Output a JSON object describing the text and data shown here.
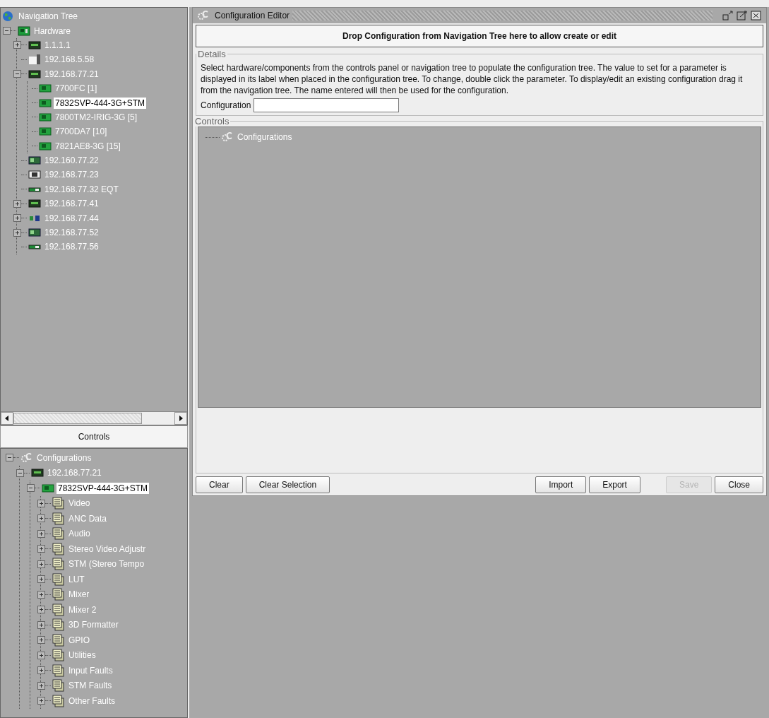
{
  "navigation_tree": {
    "root": {
      "label": "Navigation Tree",
      "kind": "globe",
      "selected": false
    },
    "items": [
      {
        "label": "Hardware",
        "kind": "rack",
        "expanded": true,
        "selected": false,
        "children": [
          {
            "label": "1.1.1.1",
            "kind": "chassis",
            "expanded": false,
            "selected": false
          },
          {
            "label": "192.168.5.58",
            "kind": "server",
            "selected": false
          },
          {
            "label": "192.168.77.21",
            "kind": "chassis",
            "expanded": true,
            "selected": false,
            "children": [
              {
                "label": "7700FC  [1]",
                "kind": "card",
                "selected": false
              },
              {
                "label": "7832SVP-444-3G+STM",
                "kind": "card",
                "selected": true
              },
              {
                "label": "7800TM2-IRIG-3G  [5]",
                "kind": "card",
                "selected": false
              },
              {
                "label": "7700DA7  [10]",
                "kind": "card",
                "selected": false
              },
              {
                "label": "7821AE8-3G  [15]",
                "kind": "card",
                "selected": false
              }
            ]
          },
          {
            "label": "192.160.77.22",
            "kind": "board",
            "selected": false
          },
          {
            "label": "192.168.77.23",
            "kind": "frame",
            "selected": false
          },
          {
            "label": "192.168.77.32 EQT",
            "kind": "slim",
            "selected": false
          },
          {
            "label": "192.168.77.41",
            "kind": "chassis",
            "expanded": false,
            "selected": false
          },
          {
            "label": "192.168.77.44",
            "kind": "link",
            "expanded": false,
            "selected": false
          },
          {
            "label": "192.168.77.52",
            "kind": "board",
            "expanded": false,
            "selected": false
          },
          {
            "label": "192.168.77.56",
            "kind": "slim",
            "selected": false
          }
        ]
      }
    ]
  },
  "controls_panel": {
    "title": "Controls",
    "items": [
      {
        "label": "Configurations",
        "kind": "config",
        "expanded": true,
        "selected": false,
        "children": [
          {
            "label": "192.168.77.21",
            "kind": "chassis",
            "expanded": true,
            "selected": false,
            "children": [
              {
                "label": "7832SVP-444-3G+STM",
                "kind": "card",
                "expanded": true,
                "selected": true,
                "children": [
                  {
                    "label": "Video",
                    "kind": "group",
                    "expanded": false,
                    "selected": false
                  },
                  {
                    "label": "ANC Data",
                    "kind": "group",
                    "expanded": false,
                    "selected": false
                  },
                  {
                    "label": "Audio",
                    "kind": "group",
                    "expanded": false,
                    "selected": false
                  },
                  {
                    "label": "Stereo Video Adjustr",
                    "kind": "group",
                    "expanded": false,
                    "selected": false
                  },
                  {
                    "label": "STM (Stereo Tempo",
                    "kind": "group",
                    "expanded": false,
                    "selected": false
                  },
                  {
                    "label": "LUT",
                    "kind": "group",
                    "expanded": false,
                    "selected": false
                  },
                  {
                    "label": "Mixer",
                    "kind": "group",
                    "expanded": false,
                    "selected": false
                  },
                  {
                    "label": "Mixer 2",
                    "kind": "group",
                    "expanded": false,
                    "selected": false
                  },
                  {
                    "label": "3D Formatter",
                    "kind": "group",
                    "expanded": false,
                    "selected": false
                  },
                  {
                    "label": "GPIO",
                    "kind": "group",
                    "expanded": false,
                    "selected": false
                  },
                  {
                    "label": "Utilities",
                    "kind": "group",
                    "expanded": false,
                    "selected": false
                  },
                  {
                    "label": "Input Faults",
                    "kind": "group",
                    "expanded": false,
                    "selected": false
                  },
                  {
                    "label": "STM Faults",
                    "kind": "group",
                    "expanded": false,
                    "selected": false
                  },
                  {
                    "label": "Other Faults",
                    "kind": "group",
                    "expanded": false,
                    "selected": false
                  }
                ]
              }
            ]
          }
        ]
      }
    ]
  },
  "editor": {
    "title": "Configuration Editor",
    "drop_target": "Drop Configuration from Navigation Tree here to allow create or edit",
    "details": {
      "legend": "Details",
      "instructions": "Select hardware/components from the controls panel or navigation tree to populate the configuration tree.  The value to set for a parameter is displayed in its label when placed in the configuration tree.  To change, double click the parameter. To display/edit an existing configuration drag it from the navigation tree.  The name entered will then be used for the configuration.",
      "configuration_label": "Configuration"
    },
    "controls": {
      "legend": "Controls",
      "items": [
        {
          "label": "Configurations",
          "kind": "config",
          "selected": false
        }
      ]
    },
    "buttons": [
      {
        "label": "Clear",
        "disabled": false
      },
      {
        "label": "Clear Selection",
        "disabled": false
      },
      {
        "label": "Import",
        "disabled": false
      },
      {
        "label": "Export",
        "disabled": false
      },
      {
        "label": "Save",
        "disabled": true
      },
      {
        "label": "Close",
        "disabled": false
      }
    ]
  }
}
